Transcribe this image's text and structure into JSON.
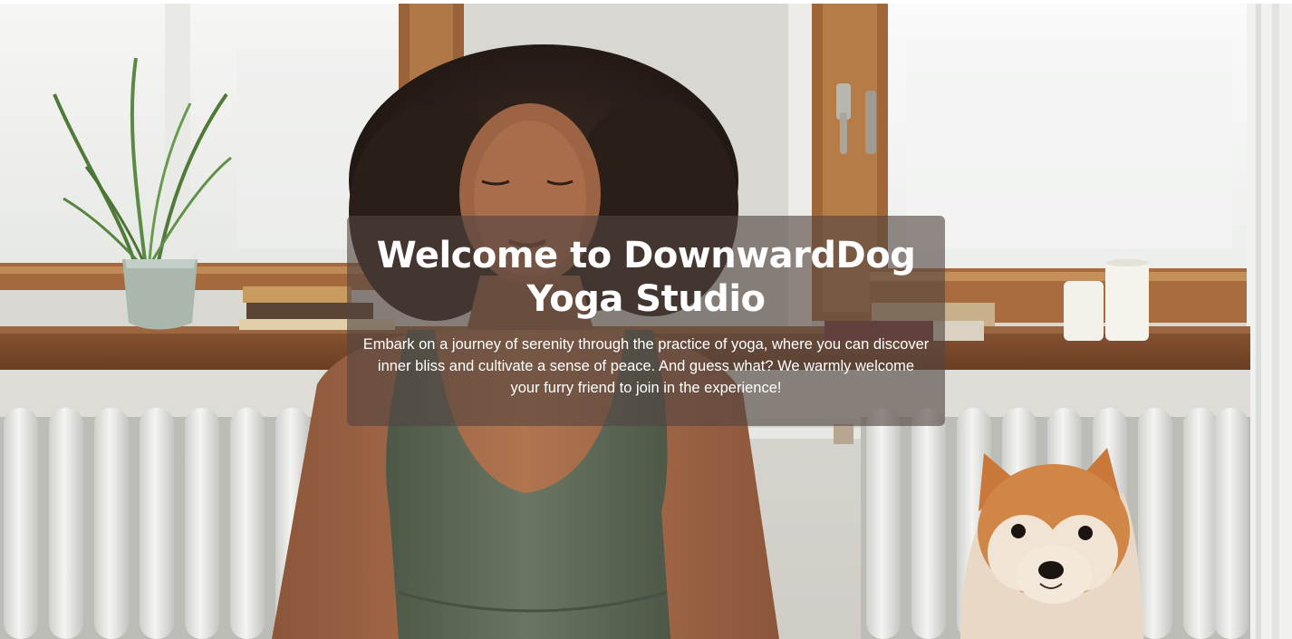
{
  "hero": {
    "title": "Welcome to DownwardDog Yoga Studio",
    "text": "Embark on a journey of serenity through the practice of yoga, where you can discover inner bliss and cultivate a sense of peace. And guess what? We warmly welcome your furry friend to join in the experience!",
    "colors": {
      "card_overlay": "#524640",
      "text": "#ffffff",
      "top_tank": "#5f6b58",
      "dog_coat": "#d48a45"
    }
  }
}
